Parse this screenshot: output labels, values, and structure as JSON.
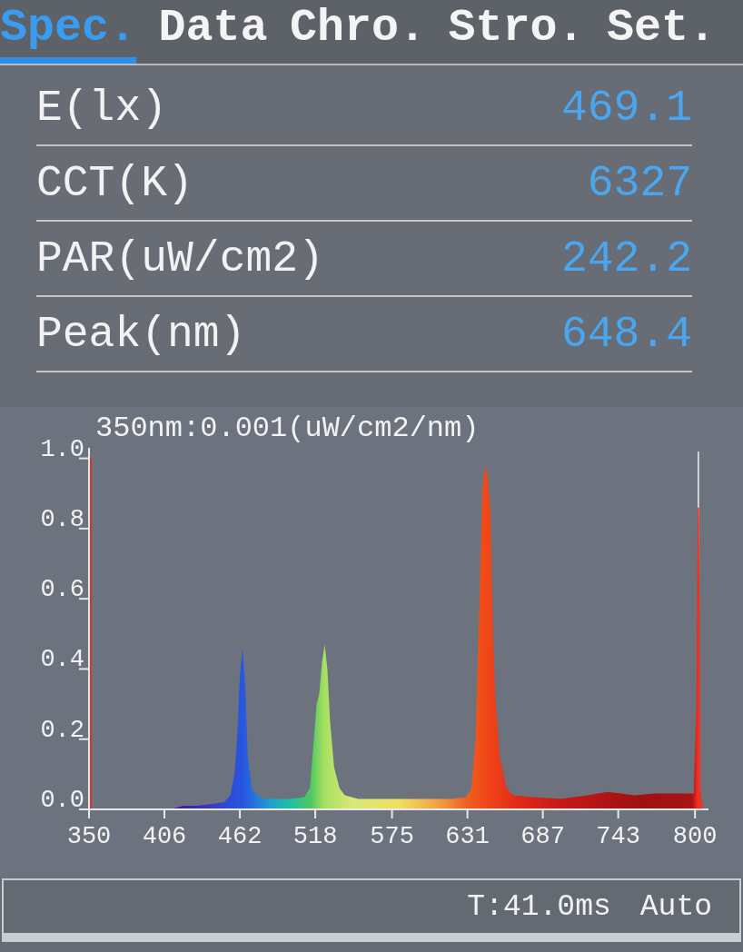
{
  "tabs": [
    {
      "label": "Spec.",
      "selected": true
    },
    {
      "label": "Data",
      "selected": false
    },
    {
      "label": "Chro.",
      "selected": false
    },
    {
      "label": "Stro.",
      "selected": false
    },
    {
      "label": "Set.",
      "selected": false
    }
  ],
  "readings": [
    {
      "label": "E(lx)",
      "value": "469.1"
    },
    {
      "label": "CCT(K)",
      "value": "6327"
    },
    {
      "label": "PAR(uW/cm2)",
      "value": "242.2"
    },
    {
      "label": "Peak(nm)",
      "value": "648.4"
    }
  ],
  "spectrum": {
    "chart_data": {
      "type": "area",
      "title": "350nm:0.001(uW/cm2/nm)",
      "x": [
        350,
        380,
        410,
        420,
        430,
        440,
        450,
        455,
        458,
        460,
        462,
        464,
        466,
        468,
        471,
        475,
        480,
        490,
        500,
        510,
        514,
        517,
        519,
        521,
        523,
        525,
        527,
        529,
        532,
        536,
        540,
        550,
        570,
        600,
        620,
        630,
        634,
        637,
        640,
        642,
        644,
        646,
        648,
        650,
        652,
        655,
        660,
        665,
        680,
        700,
        720,
        735,
        745,
        755,
        770,
        790,
        799,
        801,
        802,
        803,
        804,
        806
      ],
      "series": [
        {
          "color": "#f0f0f0",
          "values": [
            null,
            null,
            null,
            null,
            null,
            null,
            null,
            null,
            null,
            null,
            null,
            null,
            null,
            null,
            null,
            null,
            null,
            null,
            null,
            null,
            null,
            null,
            null,
            null,
            null,
            null,
            null,
            null,
            null,
            null,
            null,
            null,
            null,
            null,
            null,
            null,
            null,
            null,
            null,
            null,
            null,
            null,
            null,
            null,
            null,
            null,
            null,
            null,
            null,
            null,
            null,
            null,
            null,
            null,
            null,
            null,
            null,
            null,
            1.02,
            1.02,
            null,
            null
          ]
        },
        {
          "values": [
            0,
            0,
            0,
            0.01,
            0.01,
            0.015,
            0.02,
            0.04,
            0.1,
            0.2,
            0.38,
            0.46,
            0.35,
            0.15,
            0.06,
            0.04,
            0.03,
            0.03,
            0.03,
            0.035,
            0.06,
            0.2,
            0.3,
            0.33,
            0.42,
            0.47,
            0.4,
            0.25,
            0.12,
            0.06,
            0.04,
            0.03,
            0.03,
            0.03,
            0.03,
            0.035,
            0.06,
            0.2,
            0.6,
            0.9,
            0.98,
            0.95,
            0.85,
            0.5,
            0.3,
            0.15,
            0.06,
            0.04,
            0.035,
            0.03,
            0.04,
            0.05,
            0.045,
            0.04,
            0.045,
            0.045,
            0.045,
            0.3,
            0.86,
            0.86,
            0.05,
            0
          ]
        }
      ],
      "xlim": [
        350,
        810
      ],
      "ylim": [
        0,
        1.03
      ],
      "xticks": [
        350,
        406,
        462,
        518,
        575,
        631,
        687,
        743,
        800
      ],
      "yticks": [
        {
          "value": 0,
          "label": "0.0"
        },
        0.2,
        0.4,
        0.6,
        0.8,
        {
          "value": 1,
          "label": "1.0"
        }
      ]
    }
  },
  "status_bar": {
    "exposure": "T:41.0ms",
    "mode": "Auto"
  }
}
